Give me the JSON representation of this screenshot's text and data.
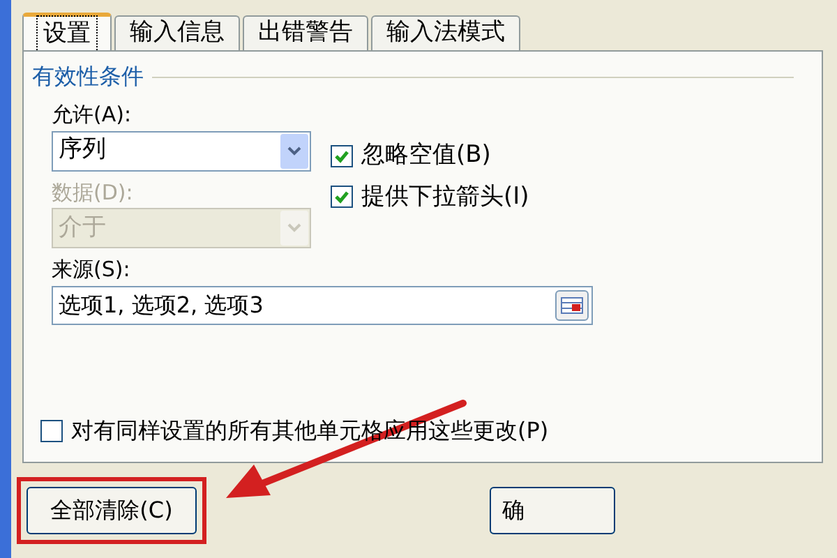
{
  "tabs": [
    {
      "label": "设置",
      "selected": true
    },
    {
      "label": "输入信息",
      "selected": false
    },
    {
      "label": "出错警告",
      "selected": false
    },
    {
      "label": "输入法模式",
      "selected": false
    }
  ],
  "group_title": "有效性条件",
  "allow": {
    "label": "允许(A):",
    "value": "序列",
    "disabled": false
  },
  "data": {
    "label": "数据(D):",
    "value": "介于",
    "disabled": true
  },
  "options": [
    {
      "label": "忽略空值(B)",
      "checked": true
    },
    {
      "label": "提供下拉箭头(I)",
      "checked": true
    }
  ],
  "source": {
    "label": "来源(S):",
    "value": "选项1, 选项2, 选项3"
  },
  "apply_all": {
    "label": "对有同样设置的所有其他单元格应用这些更改(P)",
    "checked": false
  },
  "buttons": [
    {
      "label": "全部清除(C)",
      "highlighted": true
    },
    {
      "label": "确",
      "highlighted": false
    }
  ]
}
